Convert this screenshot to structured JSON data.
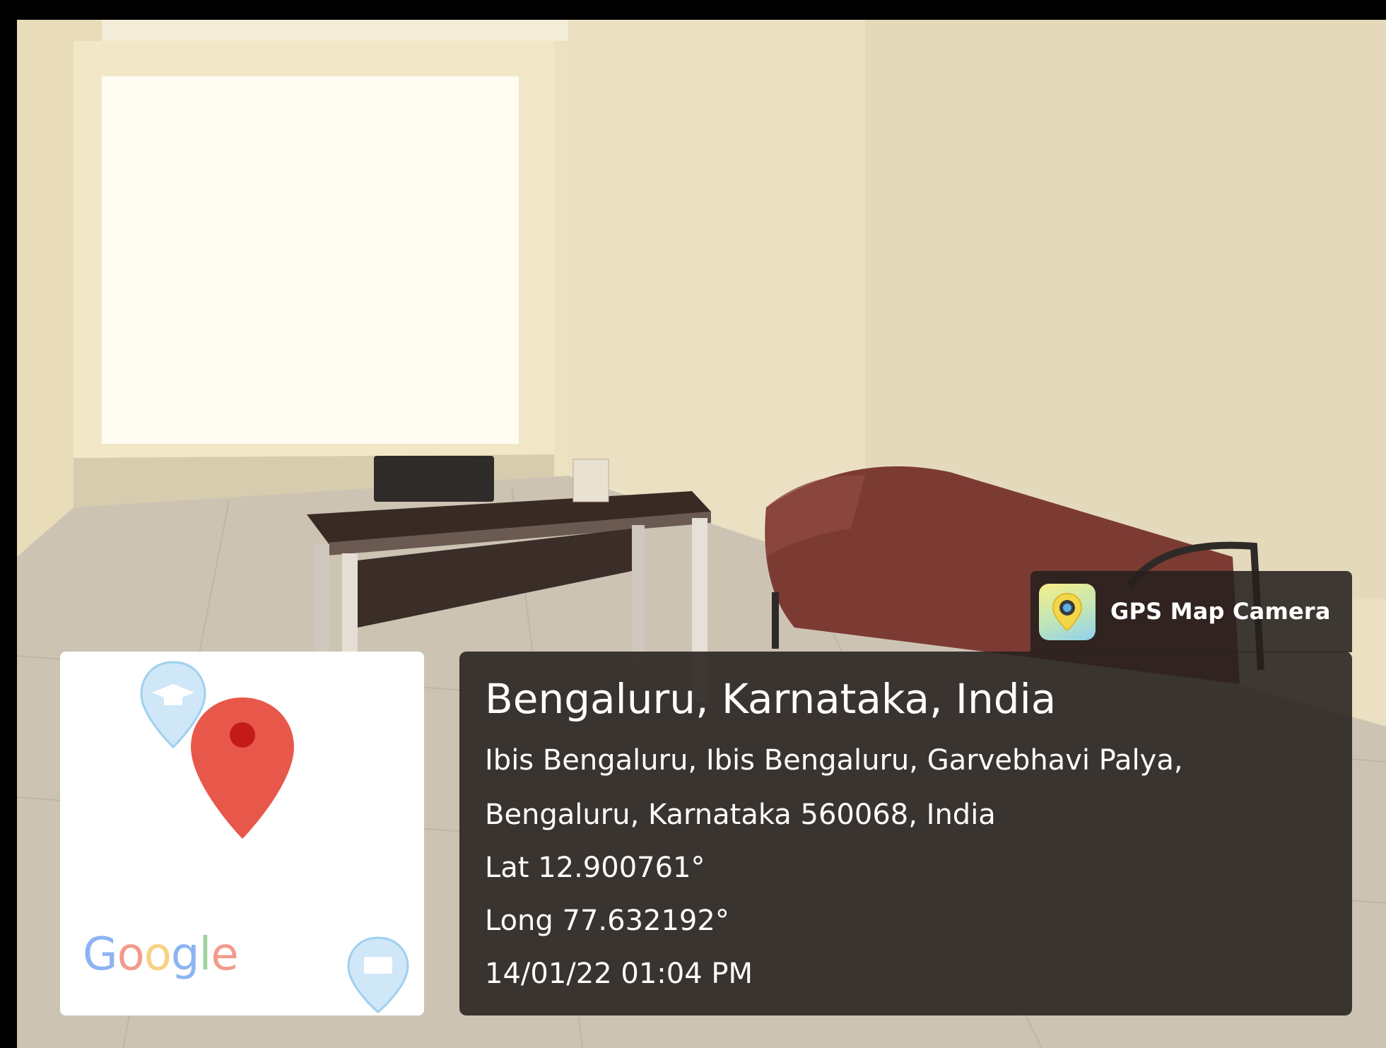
{
  "badge": {
    "app_name": "GPS Map Camera",
    "icon": "gps-map-camera-app-icon"
  },
  "location": {
    "title": "Bengaluru, Karnataka, India",
    "address_line_1": "Ibis Bengaluru, Ibis Bengaluru, Garvebhavi Palya,",
    "address_line_2": "Bengaluru, Karnataka 560068, India",
    "latitude": "Lat 12.900761°",
    "longitude": "Long 77.632192°",
    "timestamp": "14/01/22 01:04 PM"
  },
  "map": {
    "logo_text": "Google",
    "logo_letters": [
      {
        "ch": "G",
        "color": "#7aa7f0"
      },
      {
        "ch": "o",
        "color": "#f08a7a"
      },
      {
        "ch": "o",
        "color": "#f5c96a"
      },
      {
        "ch": "g",
        "color": "#7aa7f0"
      },
      {
        "ch": "l",
        "color": "#8ccc8c"
      },
      {
        "ch": "e",
        "color": "#f08a7a"
      }
    ],
    "pin_icon": "map-marker-icon",
    "school_icon": "graduation-cap-icon",
    "bank_icon": "bank-icon"
  },
  "colors": {
    "panel_bg": "#26201e",
    "marker_red": "#e8584a",
    "marker_dot": "#c41a1a"
  }
}
